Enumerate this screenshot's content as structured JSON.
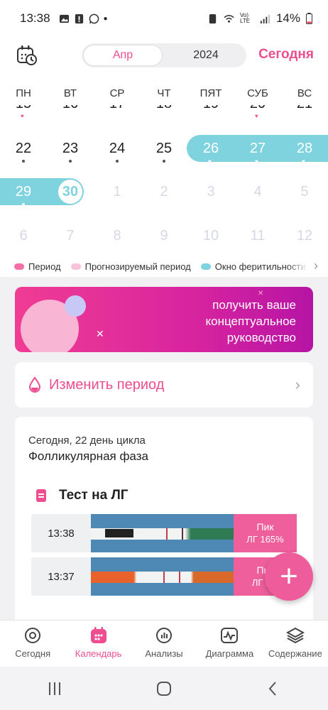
{
  "status_bar": {
    "time": "13:38",
    "battery": "14%",
    "network": "Vo) LTE"
  },
  "header": {
    "month": "Апр",
    "year": "2024",
    "today_label": "Сегодня"
  },
  "weekdays": [
    "ПН",
    "ВТ",
    "СР",
    "ЧТ",
    "ПЯТ",
    "СУБ",
    "ВС"
  ],
  "calendar": {
    "partial_row": [
      "15",
      "16",
      "17",
      "18",
      "19",
      "20",
      "21"
    ],
    "row1": [
      "22",
      "23",
      "24",
      "25",
      "26",
      "27",
      "28"
    ],
    "row2": [
      "29",
      "30",
      "1",
      "2",
      "3",
      "4",
      "5"
    ],
    "row3": [
      "6",
      "7",
      "8",
      "9",
      "10",
      "11",
      "12"
    ],
    "today": "30",
    "fertile_days": [
      "26",
      "27",
      "28",
      "29",
      "30"
    ]
  },
  "legend": {
    "period": "Период",
    "predicted": "Прогнозируемый период",
    "fertile": "Окно феритильности",
    "period_color": "#f26fa8",
    "predicted_color": "#f6c3da",
    "fertile_color": "#7fd3de"
  },
  "promo": {
    "line1": "получить ваше",
    "line2": "концептуальное",
    "line3": "руководство"
  },
  "change_period": {
    "label": "Изменить период"
  },
  "cycle": {
    "day_text": "Сегодня, 22 день цикла",
    "phase": "Фолликулярная фаза"
  },
  "lh_test": {
    "title": "Тест на ЛГ",
    "entries": [
      {
        "time": "13:38",
        "result": "Пик",
        "value": "ЛГ 165%"
      },
      {
        "time": "13:37",
        "result": "Пик",
        "value": "ЛГ 1..."
      }
    ]
  },
  "bottom_nav": [
    "Сегодня",
    "Календарь",
    "Анализы",
    "Диаграмма",
    "Содержание"
  ],
  "accent_color": "#ee4d8f"
}
